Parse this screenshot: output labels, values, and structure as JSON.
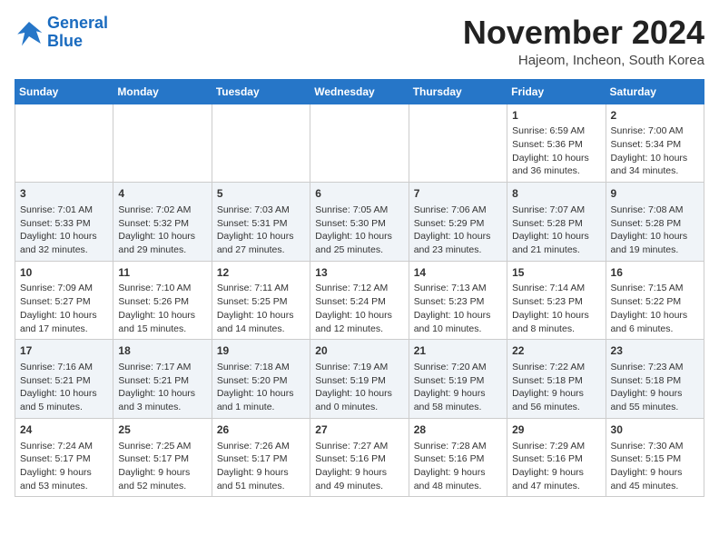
{
  "logo": {
    "line1": "General",
    "line2": "Blue"
  },
  "title": "November 2024",
  "location": "Hajeom, Incheon, South Korea",
  "weekdays": [
    "Sunday",
    "Monday",
    "Tuesday",
    "Wednesday",
    "Thursday",
    "Friday",
    "Saturday"
  ],
  "weeks": [
    [
      {
        "day": "",
        "info": ""
      },
      {
        "day": "",
        "info": ""
      },
      {
        "day": "",
        "info": ""
      },
      {
        "day": "",
        "info": ""
      },
      {
        "day": "",
        "info": ""
      },
      {
        "day": "1",
        "info": "Sunrise: 6:59 AM\nSunset: 5:36 PM\nDaylight: 10 hours and 36 minutes."
      },
      {
        "day": "2",
        "info": "Sunrise: 7:00 AM\nSunset: 5:34 PM\nDaylight: 10 hours and 34 minutes."
      }
    ],
    [
      {
        "day": "3",
        "info": "Sunrise: 7:01 AM\nSunset: 5:33 PM\nDaylight: 10 hours and 32 minutes."
      },
      {
        "day": "4",
        "info": "Sunrise: 7:02 AM\nSunset: 5:32 PM\nDaylight: 10 hours and 29 minutes."
      },
      {
        "day": "5",
        "info": "Sunrise: 7:03 AM\nSunset: 5:31 PM\nDaylight: 10 hours and 27 minutes."
      },
      {
        "day": "6",
        "info": "Sunrise: 7:05 AM\nSunset: 5:30 PM\nDaylight: 10 hours and 25 minutes."
      },
      {
        "day": "7",
        "info": "Sunrise: 7:06 AM\nSunset: 5:29 PM\nDaylight: 10 hours and 23 minutes."
      },
      {
        "day": "8",
        "info": "Sunrise: 7:07 AM\nSunset: 5:28 PM\nDaylight: 10 hours and 21 minutes."
      },
      {
        "day": "9",
        "info": "Sunrise: 7:08 AM\nSunset: 5:28 PM\nDaylight: 10 hours and 19 minutes."
      }
    ],
    [
      {
        "day": "10",
        "info": "Sunrise: 7:09 AM\nSunset: 5:27 PM\nDaylight: 10 hours and 17 minutes."
      },
      {
        "day": "11",
        "info": "Sunrise: 7:10 AM\nSunset: 5:26 PM\nDaylight: 10 hours and 15 minutes."
      },
      {
        "day": "12",
        "info": "Sunrise: 7:11 AM\nSunset: 5:25 PM\nDaylight: 10 hours and 14 minutes."
      },
      {
        "day": "13",
        "info": "Sunrise: 7:12 AM\nSunset: 5:24 PM\nDaylight: 10 hours and 12 minutes."
      },
      {
        "day": "14",
        "info": "Sunrise: 7:13 AM\nSunset: 5:23 PM\nDaylight: 10 hours and 10 minutes."
      },
      {
        "day": "15",
        "info": "Sunrise: 7:14 AM\nSunset: 5:23 PM\nDaylight: 10 hours and 8 minutes."
      },
      {
        "day": "16",
        "info": "Sunrise: 7:15 AM\nSunset: 5:22 PM\nDaylight: 10 hours and 6 minutes."
      }
    ],
    [
      {
        "day": "17",
        "info": "Sunrise: 7:16 AM\nSunset: 5:21 PM\nDaylight: 10 hours and 5 minutes."
      },
      {
        "day": "18",
        "info": "Sunrise: 7:17 AM\nSunset: 5:21 PM\nDaylight: 10 hours and 3 minutes."
      },
      {
        "day": "19",
        "info": "Sunrise: 7:18 AM\nSunset: 5:20 PM\nDaylight: 10 hours and 1 minute."
      },
      {
        "day": "20",
        "info": "Sunrise: 7:19 AM\nSunset: 5:19 PM\nDaylight: 10 hours and 0 minutes."
      },
      {
        "day": "21",
        "info": "Sunrise: 7:20 AM\nSunset: 5:19 PM\nDaylight: 9 hours and 58 minutes."
      },
      {
        "day": "22",
        "info": "Sunrise: 7:22 AM\nSunset: 5:18 PM\nDaylight: 9 hours and 56 minutes."
      },
      {
        "day": "23",
        "info": "Sunrise: 7:23 AM\nSunset: 5:18 PM\nDaylight: 9 hours and 55 minutes."
      }
    ],
    [
      {
        "day": "24",
        "info": "Sunrise: 7:24 AM\nSunset: 5:17 PM\nDaylight: 9 hours and 53 minutes."
      },
      {
        "day": "25",
        "info": "Sunrise: 7:25 AM\nSunset: 5:17 PM\nDaylight: 9 hours and 52 minutes."
      },
      {
        "day": "26",
        "info": "Sunrise: 7:26 AM\nSunset: 5:17 PM\nDaylight: 9 hours and 51 minutes."
      },
      {
        "day": "27",
        "info": "Sunrise: 7:27 AM\nSunset: 5:16 PM\nDaylight: 9 hours and 49 minutes."
      },
      {
        "day": "28",
        "info": "Sunrise: 7:28 AM\nSunset: 5:16 PM\nDaylight: 9 hours and 48 minutes."
      },
      {
        "day": "29",
        "info": "Sunrise: 7:29 AM\nSunset: 5:16 PM\nDaylight: 9 hours and 47 minutes."
      },
      {
        "day": "30",
        "info": "Sunrise: 7:30 AM\nSunset: 5:15 PM\nDaylight: 9 hours and 45 minutes."
      }
    ]
  ]
}
